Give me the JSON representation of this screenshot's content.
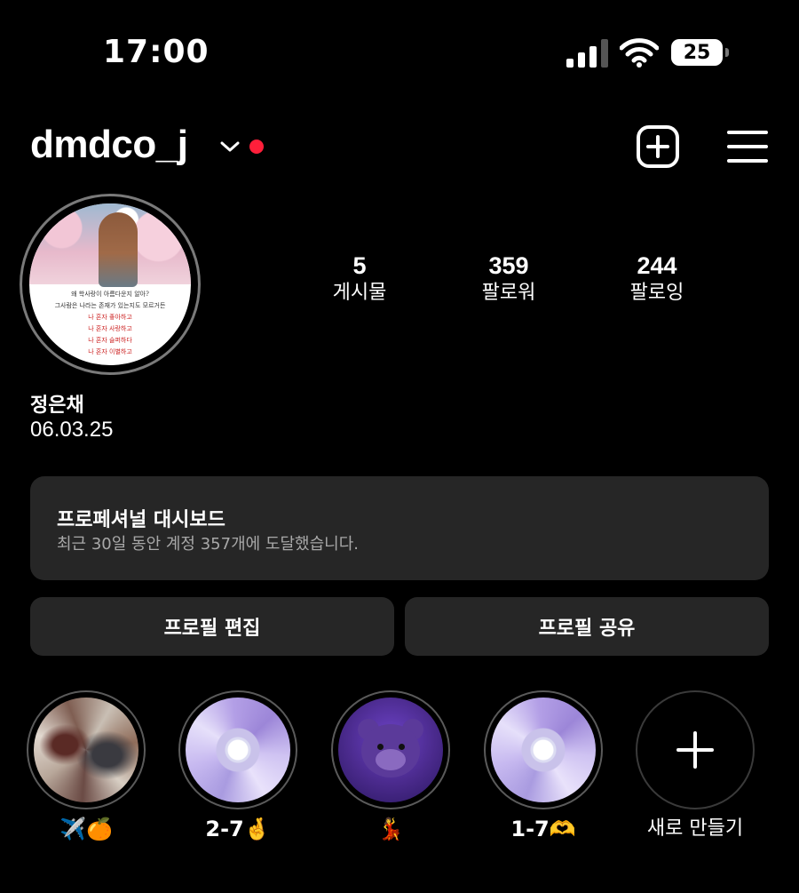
{
  "status_bar": {
    "time": "17:00",
    "battery": "25"
  },
  "header": {
    "username": "dmdco_j"
  },
  "profile": {
    "avatar_poem": [
      "왜 학사랑이 아름다운지 알아?",
      "그사람은 나라는 존재가 있는지도 모르거든",
      "나 혼자 좋아하고",
      "나 혼자 사랑하고",
      "나 혼자 슬퍼하다",
      "나 혼자 이별하고"
    ],
    "name": "정은채",
    "bio": "06.03.25"
  },
  "stats": [
    {
      "value": "5",
      "label": "게시물"
    },
    {
      "value": "359",
      "label": "팔로워"
    },
    {
      "value": "244",
      "label": "팔로잉"
    }
  ],
  "dashboard": {
    "title": "프로페셔널 대시보드",
    "subtitle": "최근 30일 동안 계정 357개에 도달했습니다."
  },
  "buttons": {
    "edit": "프로필 편집",
    "share": "프로필 공유"
  },
  "highlights": [
    {
      "label": "✈️🍊"
    },
    {
      "label": "2-7🤞"
    },
    {
      "label": "💃"
    },
    {
      "label": "1-7🫶"
    }
  ],
  "new_highlight": {
    "label": "새로 만들기"
  },
  "colors": {
    "background": "#000000",
    "card": "#262626",
    "notification": "#ff1f3a"
  }
}
